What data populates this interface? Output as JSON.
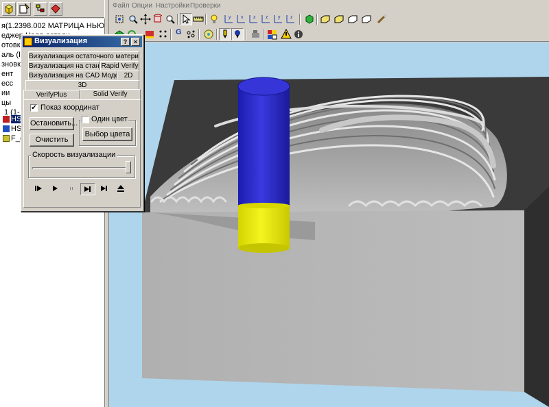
{
  "tree": {
    "rows": [
      "я(1.2398.002 МАТРИЦА НЬЮ)",
      "еджер Ноля детали",
      "отовка",
      "аль (Ia",
      "зновки",
      "ент",
      "есс",
      "ии",
      "цы",
      "1 (1- П",
      "HS",
      "HS",
      "F_("
    ]
  },
  "menu": {
    "items": [
      "Файл",
      "Опции",
      "Настройки",
      "Проверки"
    ]
  },
  "toolbar": {
    "g_label": "G"
  },
  "dialog": {
    "title": "Визуализация",
    "help_label": "?",
    "close_label": "×",
    "tabs_row1": [
      "Визуализация остаточного материала"
    ],
    "tabs_row2": [
      "Визуализация на станке",
      "Rapid Verify"
    ],
    "tabs_row3": [
      "Визуализация на CAD Модели",
      "2D"
    ],
    "tabs_row4": [
      "3D"
    ],
    "tabs_row5": [
      "VerifyPlus",
      "Solid Verify"
    ],
    "show_coords_label": "Показ координат",
    "show_coords_checked": true,
    "single_color_label": "Один цвет",
    "single_color_checked": false,
    "stop_label": "Остановить...",
    "clear_label": "Очистить",
    "color_label": "Выбор цвета",
    "speed_label": "Скорость визуализации",
    "speed_value": 1.0
  },
  "colors": {
    "viewport_bg": "#afd5ed",
    "tool_shank": "#2d2dd0",
    "tool_tip": "#e6e600",
    "stock_side": "#b4b4b4",
    "stock_top": "#3c3c3c"
  },
  "icons": {
    "play_controls": [
      "step-to-start-icon",
      "play-icon",
      "pause-icon",
      "step-forward-icon",
      "step-to-end-icon",
      "eject-icon"
    ]
  }
}
